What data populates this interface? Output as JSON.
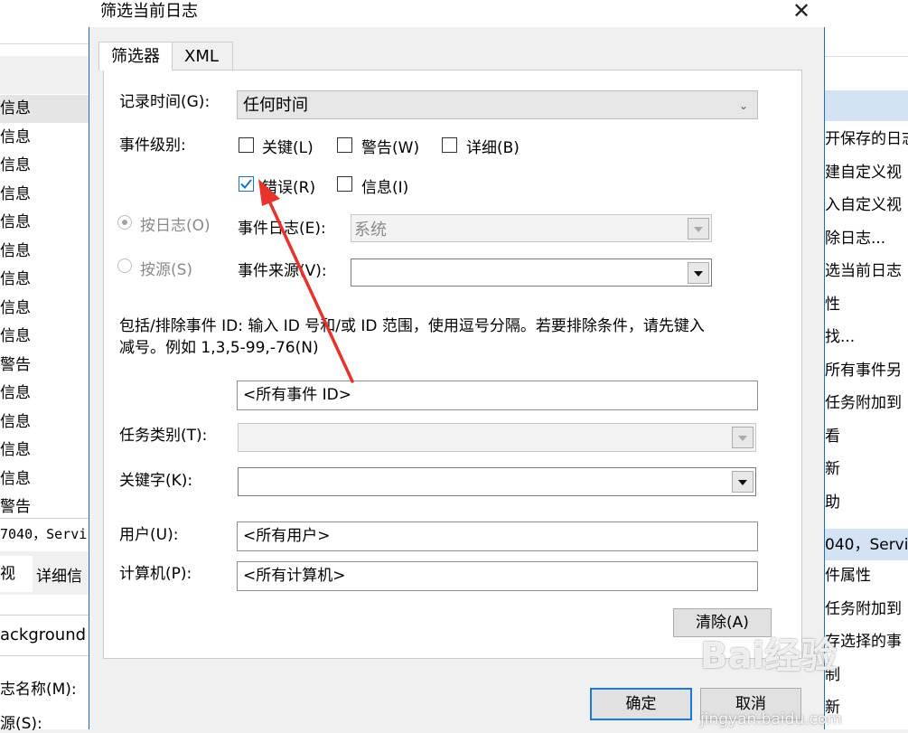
{
  "background": {
    "left_rows": [
      "信息",
      "信息",
      "信息",
      "信息",
      "信息",
      "信息",
      "信息",
      "信息",
      "信息",
      "警告",
      "信息",
      "信息",
      "信息",
      "信息",
      "警告"
    ],
    "event_line": "7040，Servi",
    "tabs": [
      "视",
      "详细信"
    ],
    "background_text": "ackground",
    "log_name_label": "志名称(M):",
    "source_label": "源(S):",
    "right_items": [
      "开保存的日志",
      "建自定义视",
      "入自定义视",
      "除日志...",
      "选当前日志",
      "性",
      "找...",
      "所有事件另",
      "任务附加到",
      "看",
      "新",
      "助"
    ],
    "right_event": "040，Servic",
    "right_items2": [
      "件属性",
      "任务附加到",
      "存选择的事",
      "制",
      "新"
    ]
  },
  "dialog": {
    "title": "筛选当前日志",
    "tabs": {
      "filter": "筛选器",
      "xml": "XML"
    },
    "time_label": "记录时间(G):",
    "time_value": "任何时间",
    "level_label": "事件级别:",
    "levels": [
      {
        "label": "关键(L)",
        "checked": false
      },
      {
        "label": "警告(W)",
        "checked": false
      },
      {
        "label": "详细(B)",
        "checked": false
      },
      {
        "label": "错误(R)",
        "checked": true
      },
      {
        "label": "信息(I)",
        "checked": false
      }
    ],
    "by_log_label": "按日志(O)",
    "by_source_label": "按源(S)",
    "event_log_label": "事件日志(E):",
    "event_log_value": "系统",
    "event_source_label": "事件来源(V):",
    "id_help": "包括/排除事件 ID: 输入 ID 号和/或 ID 范围，使用逗号分隔。若要排除条件，请先键入",
    "id_help2": "减号。例如 1,3,5-99,-76(N)",
    "event_id_value": "<所有事件 ID>",
    "task_label": "任务类别(T):",
    "keyword_label": "关键字(K):",
    "user_label": "用户(U):",
    "user_value": "<所有用户>",
    "computer_label": "计算机(P):",
    "computer_value": "<所有计算机>",
    "clear_label": "清除(A)",
    "ok_label": "确定",
    "cancel_label": "取消"
  },
  "watermark": {
    "main": "Bai经验",
    "sub": "jingyan.baidu.com"
  },
  "colors": {
    "accent": "#1b6ec2",
    "arrow": "#e8322c",
    "selected_header": "#d4e3f4"
  }
}
